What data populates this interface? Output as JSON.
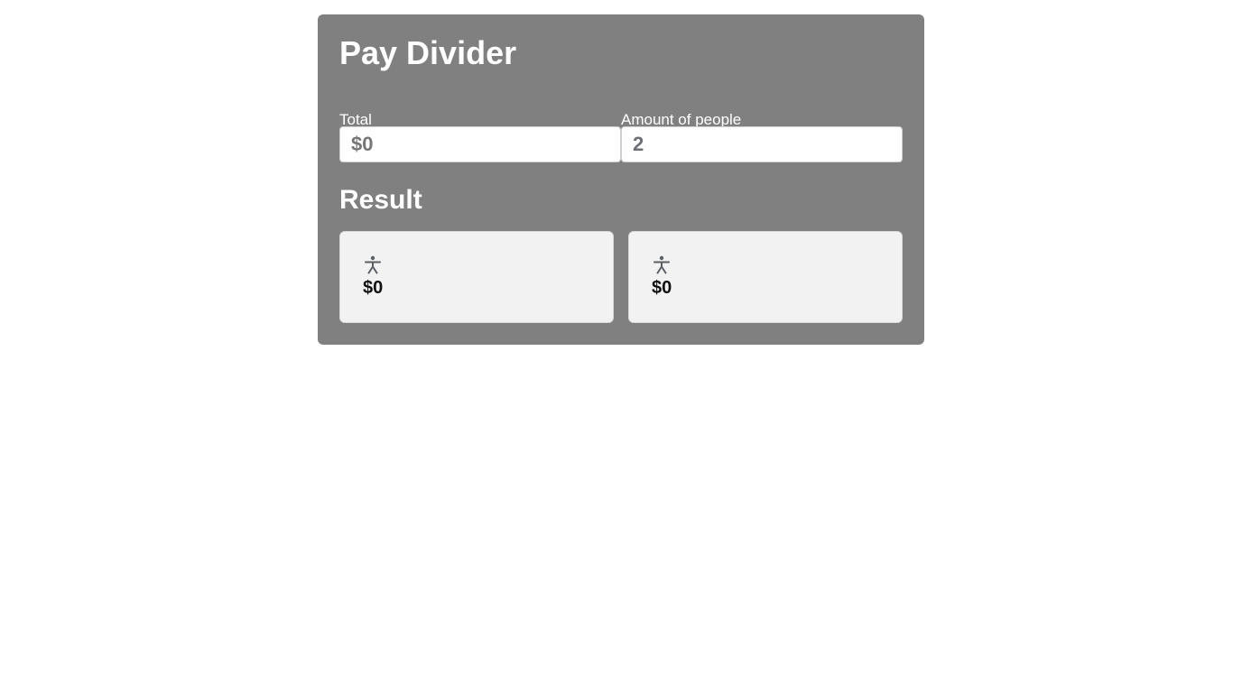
{
  "app": {
    "title": "Pay Divider"
  },
  "form": {
    "total_label": "Total",
    "total_placeholder": "$0",
    "people_label": "Amount of people",
    "people_value": "2"
  },
  "result": {
    "title": "Result",
    "people": [
      {
        "icon": "person-icon",
        "amount": "$0"
      },
      {
        "icon": "person-icon",
        "amount": "$0"
      }
    ]
  },
  "colors": {
    "panel_background": "#808080",
    "card_background": "#f2f2f2",
    "input_text": "#6b6f76",
    "heading_text": "#ffffff"
  }
}
